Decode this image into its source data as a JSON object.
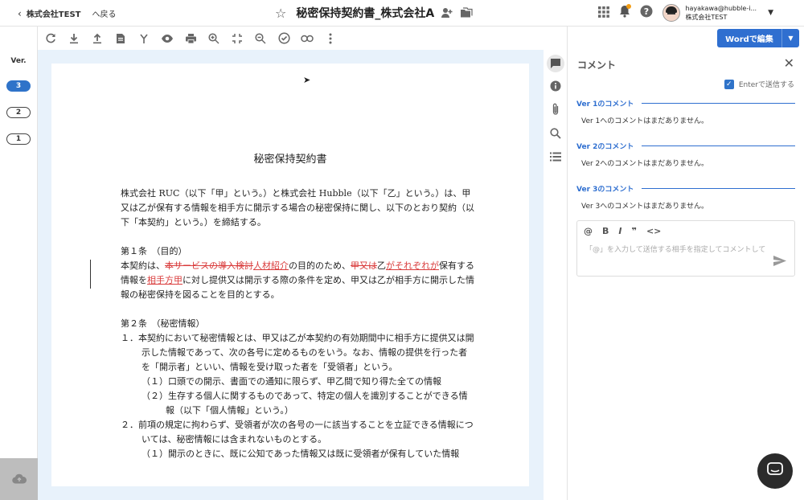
{
  "header": {
    "company_back": "株式会社TEST",
    "back_label": "へ戻る",
    "doc_title": "秘密保持契約書_株式会社A",
    "user_email": "hayakawa@hubble-i...",
    "user_company": "株式会社TEST"
  },
  "versions": {
    "label": "Ver.",
    "items": [
      "3",
      "2",
      "1"
    ],
    "active": "3"
  },
  "toolbar": {
    "icons": [
      "refresh-icon",
      "download-icon",
      "upload-icon",
      "document-icon",
      "merge-icon",
      "eye-icon",
      "print-icon",
      "zoom-in-icon",
      "fit-icon",
      "zoom-out-icon",
      "check-circle-icon",
      "link-icon",
      "more-icon"
    ],
    "word_button": "Wordで編集"
  },
  "document": {
    "title": "秘密保持契約書",
    "intro": "株式会社 RUC（以下「甲」という。）と株式会社 Hubble（以下「乙」という。）は、甲又は乙が保有する情報を相手方に開示する場合の秘密保持に関し、以下のとおり契約（以下「本契約」という。）を締結する。",
    "art1_heading": "第１条　（目的）",
    "art1_p1": "本契約は、",
    "art1_del1": "本サービスの導入検討",
    "art1_ins1": "人材紹介",
    "art1_p2": "の目的のため、",
    "art1_del2": "甲又は",
    "art1_p3": "乙",
    "art1_ins2": "がそれぞれが",
    "art1_p4": "保有する情報を",
    "art1_ins3": "相手方甲",
    "art1_p5": "に対し提供又は開示する際の条件を定め、甲又は乙が相手方に開示した情報の秘密保持を図ることを目的とする。",
    "art2_heading": "第２条　（秘密情報）",
    "art2_1": "１．本契約において秘密情報とは、甲又は乙が本契約の有効期間中に相手方に提供又は開示した情報であって、次の各号に定めるものをいう。なお、情報の提供を行った者を「開示者」といい、情報を受け取った者を「受領者」という。",
    "art2_1_1": "（１）口頭での開示、書面での通知に限らず、甲乙間で知り得た全ての情報",
    "art2_1_2": "（２）生存する個人に関するものであって、特定の個人を識別することができる情報（以下「個人情報」という。）",
    "art2_2": "２．前項の規定に拘わらず、受領者が次の各号の一に該当することを立証できる情報については、秘密情報には含まれないものとする。",
    "art2_2_1": "（１）開示のときに、既に公知であった情報又は既に受領者が保有していた情報"
  },
  "comments": {
    "title": "コメント",
    "enter_to_send": "Enterで送信する",
    "sections": [
      {
        "head": "Ver 1のコメント",
        "empty": "Ver 1へのコメントはまだありません。"
      },
      {
        "head": "Ver 2のコメント",
        "empty": "Ver 2へのコメントはまだありません。"
      },
      {
        "head": "Ver 3のコメント",
        "empty": "Ver 3へのコメントはまだありません。"
      }
    ],
    "placeholder": "「@」を入力して送信する相手を指定してコメントして"
  },
  "colors": {
    "accent": "#2f6fd0",
    "redline": "#d93b3b",
    "doc_bg": "#e8f2fb"
  }
}
